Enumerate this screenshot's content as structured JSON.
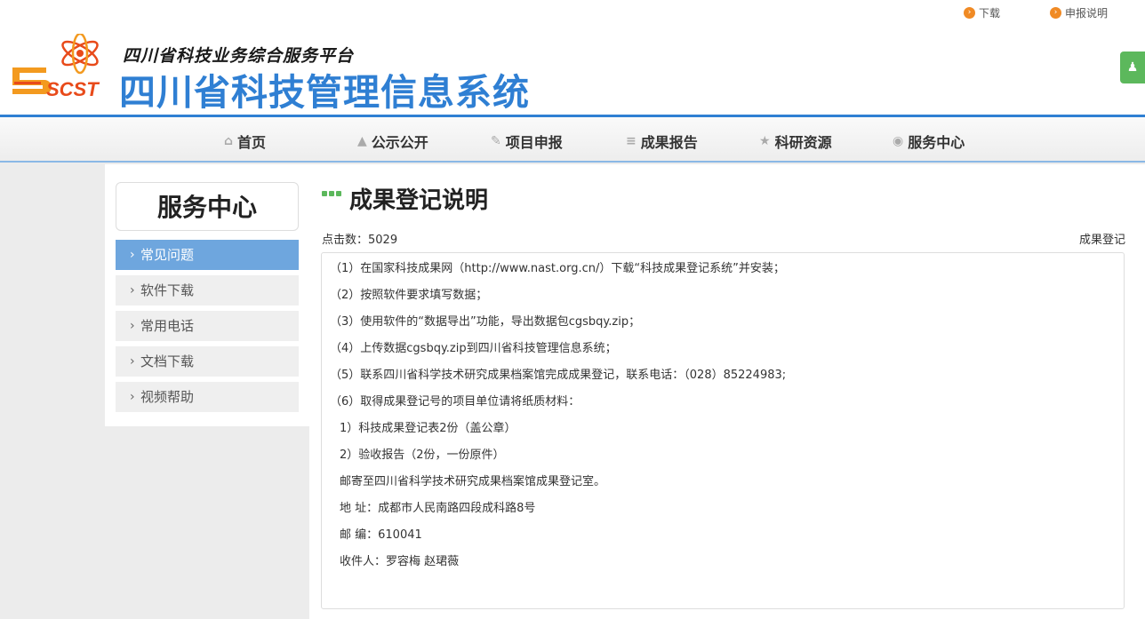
{
  "toplinks": [
    {
      "label": "下载",
      "icon": "arrow-circle-icon"
    },
    {
      "label": "申报说明",
      "icon": "arrow-circle-icon"
    }
  ],
  "header": {
    "logo_text": "SCST",
    "subtitle": "四川省科技业务综合服务平台",
    "title": "四川省科技管理信息系统",
    "accent": "#2f7fd3"
  },
  "nav": [
    {
      "label": "首页",
      "icon": "home-icon"
    },
    {
      "label": "公示公开",
      "icon": "bullhorn-icon"
    },
    {
      "label": "项目申报",
      "icon": "pencil-icon"
    },
    {
      "label": "成果报告",
      "icon": "signpost-icon"
    },
    {
      "label": "科研资源",
      "icon": "star-icon"
    },
    {
      "label": "服务中心",
      "icon": "comment-icon"
    }
  ],
  "sidebar": {
    "title": "服务中心",
    "items": [
      {
        "label": "常见问题",
        "active": true
      },
      {
        "label": "软件下载",
        "active": false
      },
      {
        "label": "常用电话",
        "active": false
      },
      {
        "label": "文档下载",
        "active": false
      },
      {
        "label": "视频帮助",
        "active": false
      }
    ]
  },
  "article": {
    "title": "成果登记说明",
    "clicks": "点击数：5029",
    "category": "成果登记",
    "lines": [
      "（1）在国家科技成果网（http://www.nast.org.cn/）下载“科技成果登记系统”并安装；",
      "（2）按照软件要求填写数据；",
      "（3）使用软件的“数据导出”功能，导出数据包cgsbqy.zip；",
      "（4）上传数据cgsbqy.zip到四川省科技管理信息系统；",
      "（5）联系四川省科学技术研究成果档案馆完成成果登记，联系电话：（028）85224983;",
      "（6）取得成果登记号的项目单位请将纸质材料：",
      "  1）科技成果登记表2份（盖公章）",
      "  2）验收报告（2份，一份原件）",
      "  邮寄至四川省科学技术研究成果档案馆成果登记室。",
      "  地 址：成都市人民南路四段成科路8号",
      "  邮 编：610041",
      "  收件人：罗容梅 赵珺薇"
    ]
  }
}
